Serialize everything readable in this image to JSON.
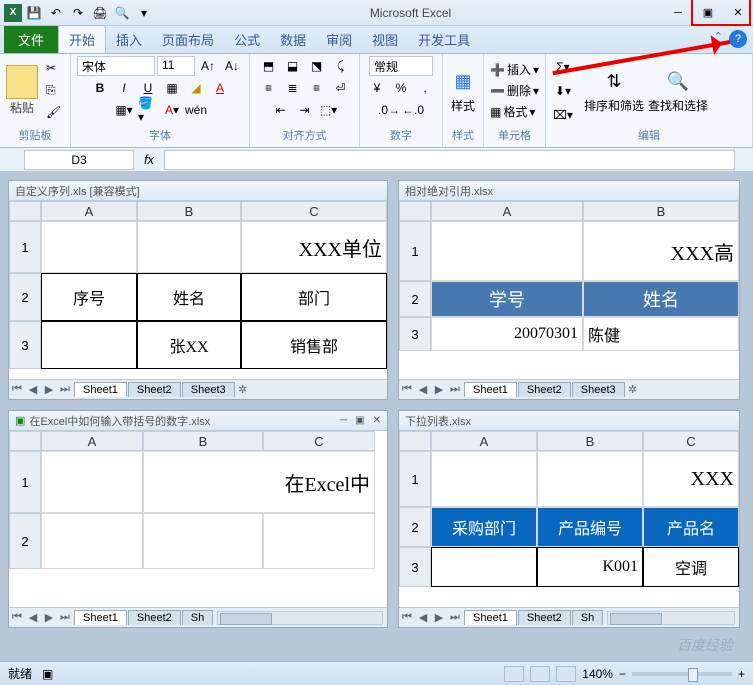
{
  "app": {
    "title": "Microsoft Excel"
  },
  "qat": {
    "save": "💾",
    "undo": "↶",
    "redo": "↷",
    "print": "🖨",
    "preview": "🔍"
  },
  "tabs": {
    "file": "文件",
    "home": "开始",
    "insert": "插入",
    "layout": "页面布局",
    "formula": "公式",
    "data": "数据",
    "review": "审阅",
    "view": "视图",
    "dev": "开发工具"
  },
  "ribbon": {
    "clipboard": {
      "label": "剪贴板",
      "paste": "粘贴"
    },
    "font": {
      "label": "字体",
      "name": "宋体",
      "size": "11",
      "bold": "B",
      "italic": "I",
      "underline": "U"
    },
    "align": {
      "label": "对齐方式"
    },
    "number": {
      "label": "数字",
      "format": "常规"
    },
    "styles": {
      "label": "样式",
      "style_btn": "样式"
    },
    "cells": {
      "label": "单元格",
      "insert": "插入",
      "delete": "删除",
      "format": "格式"
    },
    "editing": {
      "label": "编辑",
      "sort": "排序和筛选",
      "find": "查找和选择"
    }
  },
  "namebox": "D3",
  "fx": "fx",
  "windows": {
    "w1": {
      "title": "自定义序列.xls  [兼容模式]",
      "cols": [
        "A",
        "B",
        "C"
      ],
      "r1": {
        "c": "XXX单位"
      },
      "r2": {
        "a": "序号",
        "b": "姓名",
        "c": "部门"
      },
      "r3": {
        "b": "张XX",
        "c": "销售部"
      },
      "sheets": [
        "Sheet1",
        "Sheet2",
        "Sheet3"
      ]
    },
    "w2": {
      "title": "相对绝对引用.xlsx",
      "cols": [
        "A",
        "B"
      ],
      "r1": {
        "b": "XXX高"
      },
      "r2": {
        "a": "学号",
        "b": "姓名"
      },
      "r3": {
        "a": "20070301",
        "b": "陈健"
      },
      "sheets": [
        "Sheet1",
        "Sheet2",
        "Sheet3"
      ]
    },
    "w3": {
      "title": "在Excel中如何输入带括号的数字.xlsx",
      "cols": [
        "A",
        "B",
        "C"
      ],
      "r1": {
        "text": "在Excel中"
      },
      "sheets": [
        "Sheet1",
        "Sheet2",
        "Sh"
      ]
    },
    "w4": {
      "title": "下拉列表.xlsx",
      "cols": [
        "A",
        "B",
        "C"
      ],
      "r1": {
        "c": "XXX"
      },
      "r2": {
        "a": "采购部门",
        "b": "产品编号",
        "c": "产品名"
      },
      "r3": {
        "b": "K001",
        "c": "空调"
      },
      "sheets": [
        "Sheet1",
        "Sheet2",
        "Sh"
      ]
    }
  },
  "status": {
    "ready": "就绪",
    "zoom": "140%"
  },
  "watermark": "百度经验"
}
